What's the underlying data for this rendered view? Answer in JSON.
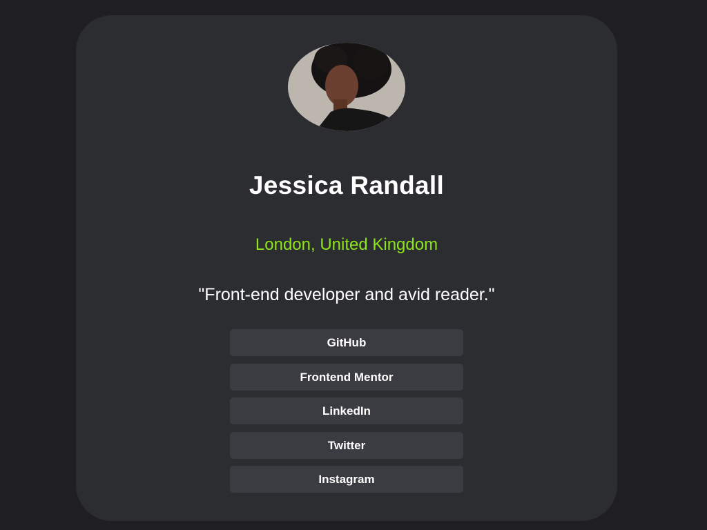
{
  "profile": {
    "avatar_alt": "profile photo",
    "name": "Jessica Randall",
    "location": "London, United Kingdom",
    "bio": "\"Front-end developer and avid reader.\""
  },
  "links": [
    {
      "label": "GitHub"
    },
    {
      "label": "Frontend Mentor"
    },
    {
      "label": "LinkedIn"
    },
    {
      "label": "Twitter"
    },
    {
      "label": "Instagram"
    }
  ],
  "colors": {
    "page_background": "#1f1f23",
    "card_background": "#2c2d31",
    "button_background": "#3a3c41",
    "accent": "#8ee51a",
    "text": "#ffffff"
  }
}
